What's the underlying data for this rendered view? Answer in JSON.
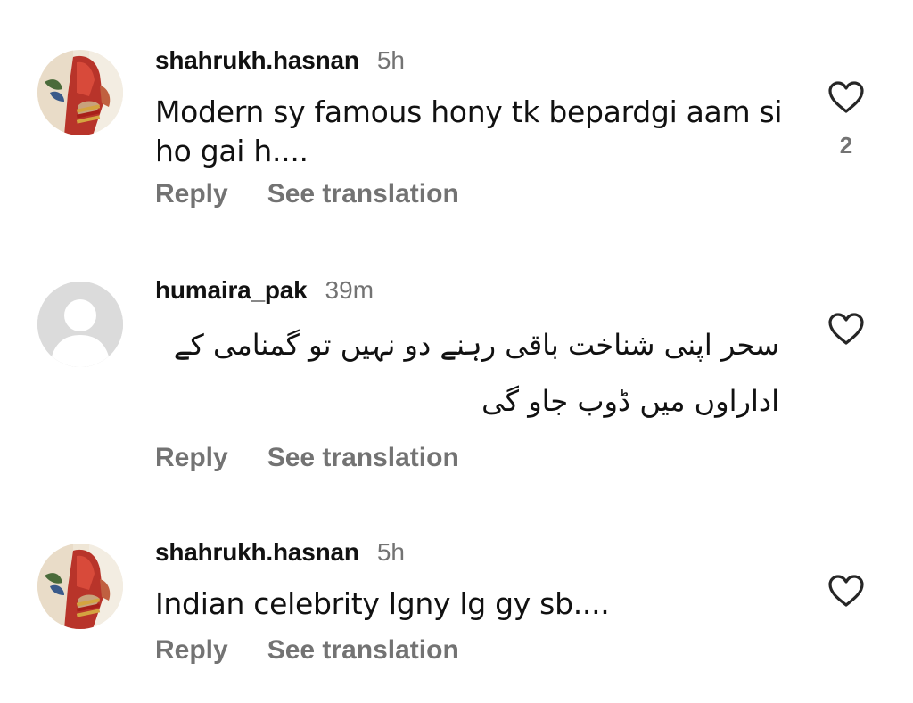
{
  "comments": [
    {
      "username": "shahrukh.hasnan",
      "time": "5h",
      "text": "Modern sy famous hony tk bepardgi aam si ho gai h....",
      "reply_label": "Reply",
      "translate_label": "See translation",
      "like_count": "2",
      "avatar_icon": "profile-photo-red-dress",
      "like_icon": "heart-outline-icon"
    },
    {
      "username": "humaira_pak",
      "time": "39m",
      "text": "سحر اپنی شناخت باقی رہنے دو نہیں تو گمنامی کے اداراوں میں ڈوب جاو گی",
      "reply_label": "Reply",
      "translate_label": "See translation",
      "avatar_icon": "default-avatar-icon",
      "like_icon": "heart-outline-icon"
    },
    {
      "username": "shahrukh.hasnan",
      "time": "5h",
      "text": "Indian celebrity lgny lg gy sb....",
      "reply_label": "Reply",
      "translate_label": "See translation",
      "avatar_icon": "profile-photo-red-dress",
      "like_icon": "heart-outline-icon"
    }
  ],
  "colors": {
    "text": "#111111",
    "secondary": "#737373",
    "default_avatar_bg": "#dbdbdb"
  }
}
